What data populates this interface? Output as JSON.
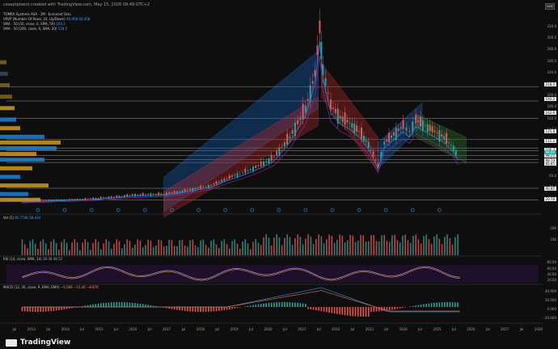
{
  "header": {
    "left_text": "ceseptpioent created with TradingView.com, May 15, 2026 09:49 UTC+2",
    "currency": "NOK"
  },
  "legend": {
    "title": "TOMRA Systems ASA · 1M · Euronext Oslo",
    "line2": "VRVP (Number Of Rows, 24, Up/Down)",
    "line2_val": "40.958 46.458",
    "line3": "SMA · 50 (50, close, 0, SMA, 50)",
    "line3_val": "103.3",
    "line4": "SMA · 50 (200, close, 0, SMA, 20)",
    "line4_val": "129.5"
  },
  "panes": {
    "vol_label": "Vol (Σ)",
    "vol_val": "95.774K  58.434",
    "rsi_label": "RSI (14, close, SMA, 14)",
    "rsi_val": "39.38  48.52",
    "macd_label": "MACD (12, 26, close, 9, EMA, EMA)",
    "macd_val": "−6.588  −13.46  −8.876"
  },
  "footer": {
    "brand": "TradingView"
  },
  "chart_data": {
    "type": "candlestick",
    "title": "TOMRA Systems ASA · 1M · Euronext Oslo",
    "x_ticks": [
      "Jul",
      "2013",
      "Jul",
      "2014",
      "Jul",
      "2015",
      "Jul",
      "2016",
      "Jul",
      "2017",
      "Jul",
      "2018",
      "Jul",
      "2019",
      "Jul",
      "2020",
      "Jul",
      "2021",
      "Jul",
      "2022",
      "Jul",
      "2023",
      "Jul",
      "2024",
      "Jul",
      "2025",
      "Jul",
      "2026",
      "Jul",
      "2027",
      "Jul",
      "2028"
    ],
    "y_ticks": [
      "320.0",
      "300.0",
      "280.0",
      "260.0",
      "240.0",
      "220.0",
      "200.0",
      "180.0",
      "160.0",
      "140.0",
      "120.0",
      "100.0",
      "80.0",
      "60.0",
      "40.0",
      "20.0"
    ],
    "price_tags": [
      "218.3",
      "193.2",
      "162.6",
      "125.8",
      "111.2",
      "106.3",
      "98.25",
      "90.74",
      "85.85",
      "40.85",
      "20.78"
    ],
    "current_price_tag": "96.00",
    "volume_ticks": [
      "20K",
      "10K"
    ],
    "rsi_ticks": [
      "80.00",
      "60.00",
      "40.00",
      "20.00"
    ],
    "macd_ticks": [
      "40.000",
      "20.000",
      "0.000",
      "-20.000"
    ],
    "path": [
      [
        2012.5,
        18
      ],
      [
        2013,
        19
      ],
      [
        2013.5,
        20
      ],
      [
        2014,
        21
      ],
      [
        2014.5,
        22
      ],
      [
        2015,
        24
      ],
      [
        2015.5,
        26
      ],
      [
        2016,
        29
      ],
      [
        2016.5,
        30
      ],
      [
        2017,
        31
      ],
      [
        2017.5,
        35
      ],
      [
        2018,
        40
      ],
      [
        2018.5,
        46
      ],
      [
        2019,
        58
      ],
      [
        2019.5,
        68
      ],
      [
        2020,
        80
      ],
      [
        2020.5,
        95
      ],
      [
        2021,
        130
      ],
      [
        2021.5,
        180
      ],
      [
        2021.8,
        240
      ],
      [
        2021.95,
        320
      ],
      [
        2022.05,
        250
      ],
      [
        2022.3,
        185
      ],
      [
        2022.6,
        165
      ],
      [
        2022.9,
        155
      ],
      [
        2023.2,
        140
      ],
      [
        2023.5,
        118
      ],
      [
        2023.8,
        80
      ],
      [
        2024.0,
        120
      ],
      [
        2024.3,
        135
      ],
      [
        2024.6,
        150
      ],
      [
        2024.8,
        140
      ],
      [
        2025.0,
        160
      ],
      [
        2025.3,
        150
      ],
      [
        2025.6,
        140
      ],
      [
        2025.9,
        130
      ],
      [
        2026.2,
        112
      ],
      [
        2026.35,
        96
      ]
    ],
    "ylim": [
      0,
      330
    ],
    "xlim": [
      2012.0,
      2028.9
    ]
  }
}
